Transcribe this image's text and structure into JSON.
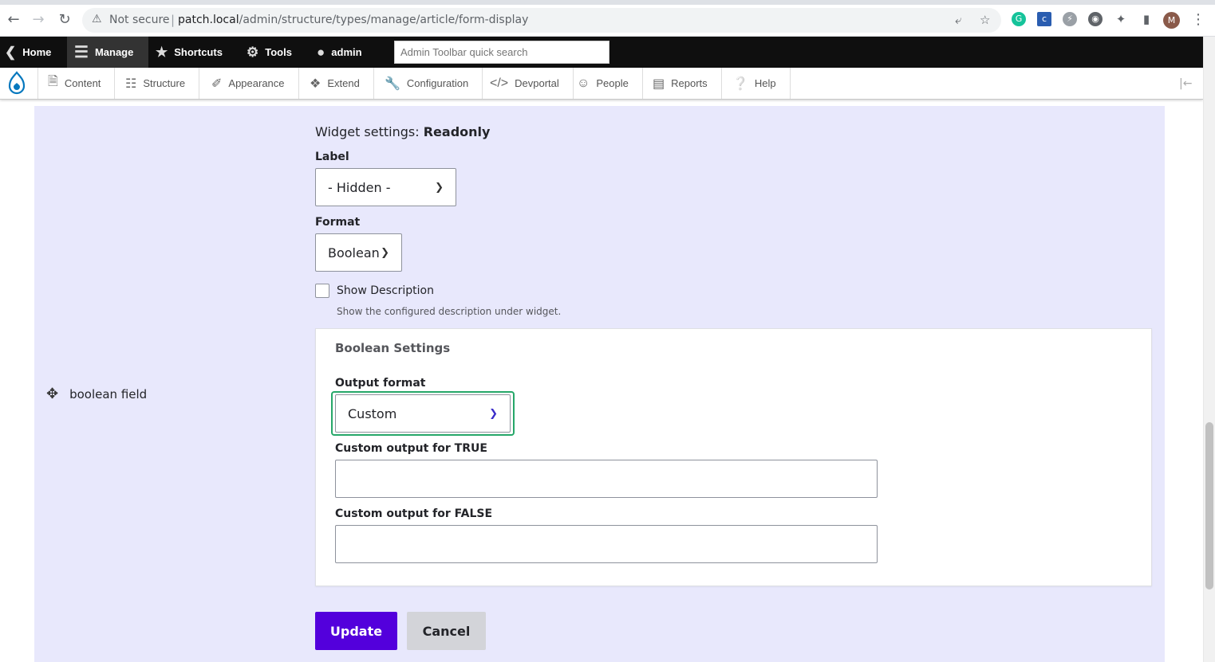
{
  "browser": {
    "security_label": "Not secure",
    "url_host": "patch.local",
    "url_path": "/admin/structure/types/manage/article/form-display",
    "profile_initial": "M"
  },
  "toolbar": {
    "home": "Home",
    "manage": "Manage",
    "shortcuts": "Shortcuts",
    "tools": "Tools",
    "user": "admin",
    "search_placeholder": "Admin Toolbar quick search"
  },
  "tray": {
    "items": [
      "Content",
      "Structure",
      "Appearance",
      "Extend",
      "Configuration",
      "Devportal",
      "People",
      "Reports",
      "Help"
    ]
  },
  "field": {
    "name": "boolean field"
  },
  "widget": {
    "settings_prefix": "Widget settings: ",
    "settings_name": "Readonly",
    "label_label": "Label",
    "label_value": "- Hidden -",
    "format_label": "Format",
    "format_value": "Boolean",
    "show_description_label": "Show Description",
    "show_description_checked": false,
    "show_description_help": "Show the configured description under widget."
  },
  "boolean_settings": {
    "title": "Boolean Settings",
    "output_format_label": "Output format",
    "output_format_value": "Custom",
    "custom_true_label": "Custom output for TRUE",
    "custom_true_value": "",
    "custom_false_label": "Custom output for FALSE",
    "custom_false_value": ""
  },
  "actions": {
    "update": "Update",
    "cancel": "Cancel"
  },
  "colors": {
    "primary_button": "#5300dc",
    "focus_ring": "#26a769",
    "row_highlight": "#e8e8fc"
  }
}
